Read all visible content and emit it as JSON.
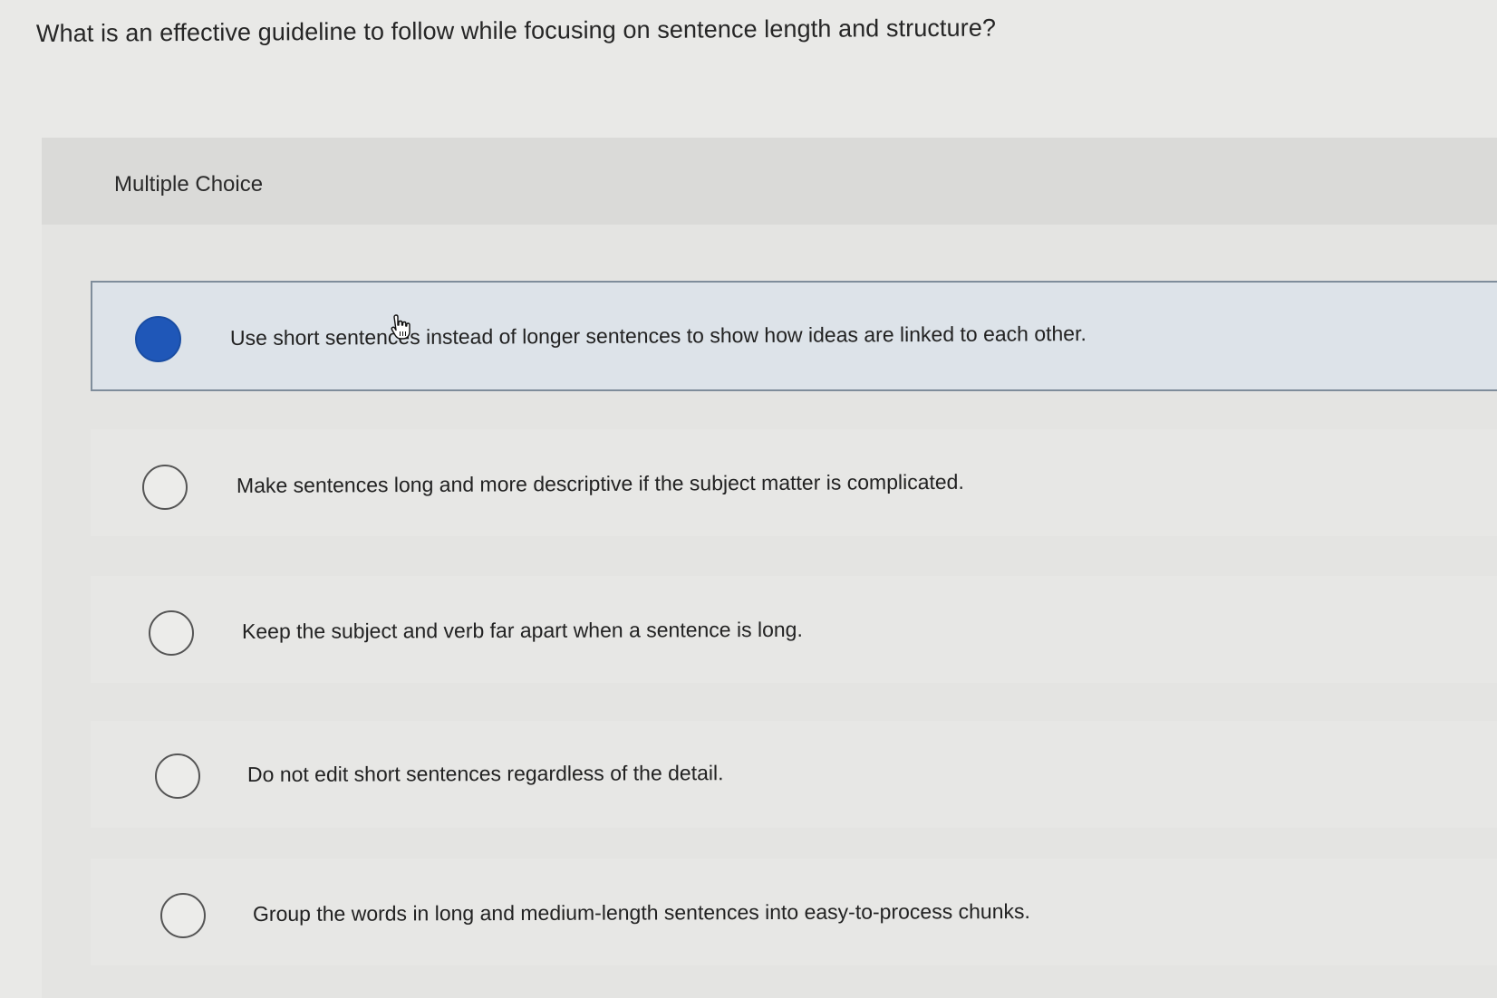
{
  "question": "What is an effective guideline to follow while focusing on sentence length and structure?",
  "section_label": "Multiple Choice",
  "options": [
    {
      "label": "Use short sentences instead of longer sentences to show how ideas are linked to each other.",
      "selected": true
    },
    {
      "label": "Make sentences long and more descriptive if the subject matter is complicated.",
      "selected": false
    },
    {
      "label": "Keep the subject and verb far apart when a sentence is long.",
      "selected": false
    },
    {
      "label": "Do not edit short sentences regardless of the detail.",
      "selected": false
    },
    {
      "label": "Group the words in long and medium-length sentences into easy-to-process chunks.",
      "selected": false
    }
  ],
  "colors": {
    "selected_radio": "#1f57b8",
    "selected_background": "#dde3e9",
    "selected_border": "#7f8d9b"
  }
}
